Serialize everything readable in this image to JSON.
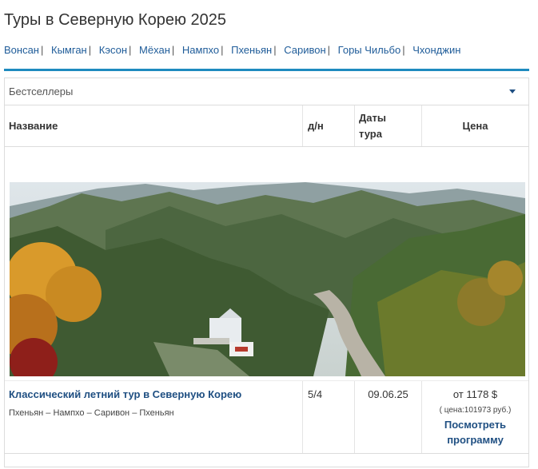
{
  "page": {
    "title": "Туры в Северную Корею 2025"
  },
  "city_nav": [
    {
      "label": "Вонсан"
    },
    {
      "label": "Кымган"
    },
    {
      "label": "Кэсон"
    },
    {
      "label": "Мёхан"
    },
    {
      "label": "Нампхо"
    },
    {
      "label": "Пхеньян"
    },
    {
      "label": "Саривон"
    },
    {
      "label": "Горы Чильбо"
    },
    {
      "label": "Чхонджин"
    }
  ],
  "nav_separator": "|",
  "sort": {
    "selected": "Бестселлеры"
  },
  "table": {
    "headers": {
      "name": "Название",
      "dn": "д/н",
      "dates_line1": "Даты",
      "dates_line2": "тура",
      "price": "Цена"
    }
  },
  "tours": [
    {
      "title": "Классический летний тур в Северную Корею",
      "route": "Пхеньян – Нампхо – Саривон – Пхеньян",
      "dn": "5/4",
      "date": "09.06.25",
      "price_from": "от 1178 $",
      "price_rub": "( цена:101973 руб.)",
      "program_line1": "Посмотреть",
      "program_line2": "программу"
    }
  ],
  "colors": {
    "accent": "#1e8bbf",
    "link": "#1f5c99",
    "heading_link": "#1f4f82"
  }
}
